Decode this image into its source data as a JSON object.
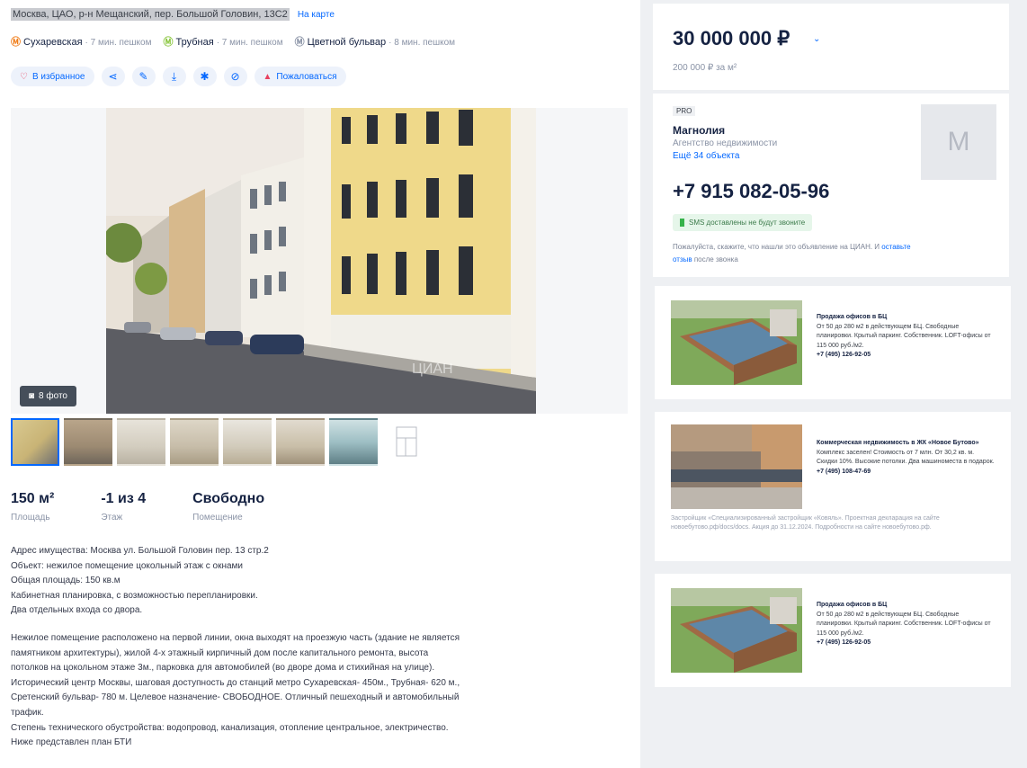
{
  "address": {
    "text": "Москва, ЦАО, р-н Мещанский, пер. Большой Головин, 13С2",
    "map_link": "На карте"
  },
  "metro": [
    {
      "name": "Сухаревская",
      "walk": "· 7 мин. пешком",
      "color": "#f07d1a"
    },
    {
      "name": "Трубная",
      "walk": "· 7 мин. пешком",
      "color": "#8ac63f"
    },
    {
      "name": "Цветной бульвар",
      "walk": "· 8 мин. пешком",
      "color": "#8a93a6"
    }
  ],
  "actions": {
    "favorite": "В избранное",
    "complain": "Пожаловаться"
  },
  "photo": {
    "count_label": "8 фото",
    "watermark": "ЦИАН"
  },
  "facts": [
    {
      "value": "150 м²",
      "label": "Площадь"
    },
    {
      "value": "-1 из 4",
      "label": "Этаж"
    },
    {
      "value": "Свободно",
      "label": "Помещение"
    }
  ],
  "description": {
    "lines_a": [
      "Адрес имущества: Москва ул. Большой Головин пер. 13 стр.2",
      "Объект: нежилое помещение цокольный этаж с окнами",
      "Общая площадь: 150 кв.м",
      "Кабинетная планировка, с возможностью перепланировки.",
      "Два отдельных входа со двора."
    ],
    "lines_b": [
      "Нежилое помещение расположено на первой линии, окна выходят на проезжую часть (здание не является",
      "памятником архитектуры), жилой 4-х этажный кирпичный дом после капитального ремонта, высота",
      "потолков на цокольном этаже 3м., парковка для автомобилей (во дворе дома и стихийная на улице).",
      "Исторический центр Москвы, шаговая доступность до станций метро Сухаревская- 450м., Трубная- 620 м.,",
      "Сретенский бульвар- 780 м. Целевое назначение- СВОБОДНОЕ. Отличный пешеходный и автомобильный",
      "трафик.",
      "Степень технического обустройства: водопровод, канализация, отопление центральное, электричество.",
      "Ниже представлен план БТИ"
    ]
  },
  "price": {
    "value": "30 000 000 ₽",
    "per_sqm": "200 000 ₽ за м²"
  },
  "agent": {
    "badge": "PRO",
    "name": "Магнолия",
    "type": "Агентство недвижимости",
    "more": "Ещё 34 объекта",
    "logo_letter": "M",
    "phone": "+7 915 082-05-96",
    "sms_note": "SMS доставлены не будут звоните",
    "mention_a": "Пожалуйста, скажите, что нашли это объявление на ЦИАН. И ",
    "mention_link": "оставьте отзыв",
    "mention_b": " после звонка"
  },
  "ads": [
    {
      "title": "Продажа офисов в БЦ",
      "text": "От 50 до 280 м2 в действующем БЦ. Свободные планировки. Крытый паркинг. Собственник. LOFT-офисы от 115 000 руб./м2.",
      "phone": "+7 (495) 126-92-05"
    },
    {
      "title": "Коммерческая недвижимость в ЖК «Новое Бутово»",
      "text": "Комплекс заселен! Стоимость от 7 млн. От 30,2 кв. м. Скидки 10%. Высокие потолки. Два машиноместа в подарок.",
      "phone": "+7 (495) 108-47-69",
      "disclaimer": "Застройщик «Специализированный застройщик «Ковяль». Проектная декларация на сайте новоебутово.рф/docs/docs. Акция до 31.12.2024. Подробности на сайте новоебутово.рф."
    },
    {
      "title": "Продажа офисов в БЦ",
      "text": "От 50 до 280 м2 в действующем БЦ. Свободные планировки. Крытый паркинг. Собственник. LOFT-офисы от 115 000 руб./м2.",
      "phone": "+7 (495) 126-92-05"
    }
  ]
}
